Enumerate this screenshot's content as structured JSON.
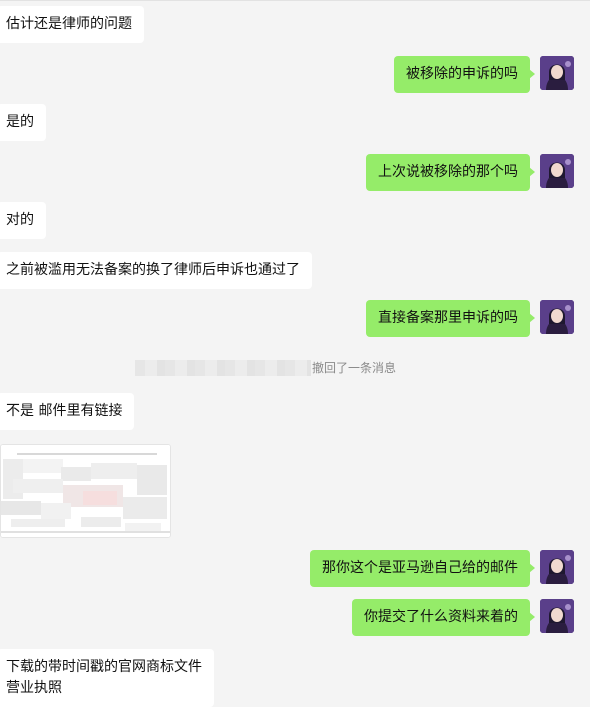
{
  "conversation": {
    "messages": [
      {
        "side": "left",
        "type": "text",
        "text": "估计还是律师的问题"
      },
      {
        "side": "right",
        "type": "text",
        "text": "被移除的申诉的吗"
      },
      {
        "side": "left",
        "type": "text",
        "text": "是的"
      },
      {
        "side": "right",
        "type": "text",
        "text": "上次说被移除的那个吗"
      },
      {
        "side": "left",
        "type": "text",
        "text": "对的"
      },
      {
        "side": "left",
        "type": "text",
        "text": "之前被滥用无法备案的换了律师后申诉也通过了"
      },
      {
        "side": "right",
        "type": "text",
        "text": "直接备案那里申诉的吗"
      },
      {
        "side": "center",
        "type": "system",
        "text": "撤回了一条消息"
      },
      {
        "side": "left",
        "type": "text",
        "text": "不是 邮件里有链接"
      },
      {
        "side": "left",
        "type": "image",
        "alt": "blurred screenshot"
      },
      {
        "side": "right",
        "type": "text",
        "text": "那你这个是亚马逊自己给的邮件"
      },
      {
        "side": "right",
        "type": "text",
        "text": "你提交了什么资料来着的"
      },
      {
        "side": "left",
        "type": "text",
        "lines": [
          "下载的带时间戳的官网商标文件",
          "营业执照"
        ]
      }
    ]
  },
  "colors": {
    "background": "#f4f4f4",
    "bubble_self": "#95ec69",
    "bubble_other": "#ffffff",
    "system_text": "#8a8a8a"
  },
  "icons": {
    "avatar": "user-avatar-icon"
  }
}
